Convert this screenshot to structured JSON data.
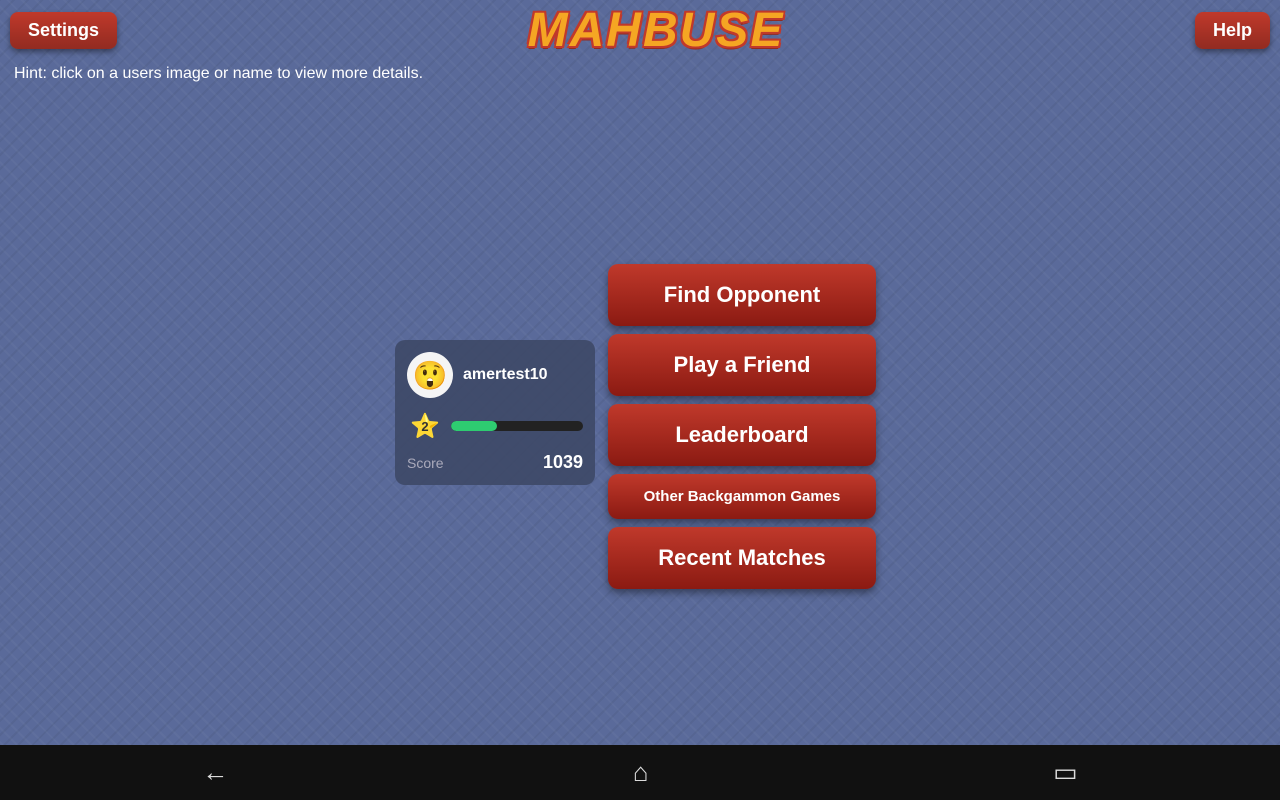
{
  "app": {
    "title": "MAHBUSE"
  },
  "header": {
    "settings_label": "Settings",
    "help_label": "Help"
  },
  "hint": {
    "text": "Hint: click on a users image or name to view more details."
  },
  "player": {
    "name": "amertest10",
    "avatar_emoji": "😲",
    "level": "2",
    "score_label": "Score",
    "score_value": "1039",
    "progress_percent": 35
  },
  "menu": {
    "find_opponent": "Find Opponent",
    "play_friend": "Play a Friend",
    "leaderboard": "Leaderboard",
    "other_games": "Other Backgammon Games",
    "recent_matches": "Recent Matches"
  },
  "nav": {
    "back_icon": "←",
    "home_icon": "⌂",
    "recent_icon": "▭"
  }
}
